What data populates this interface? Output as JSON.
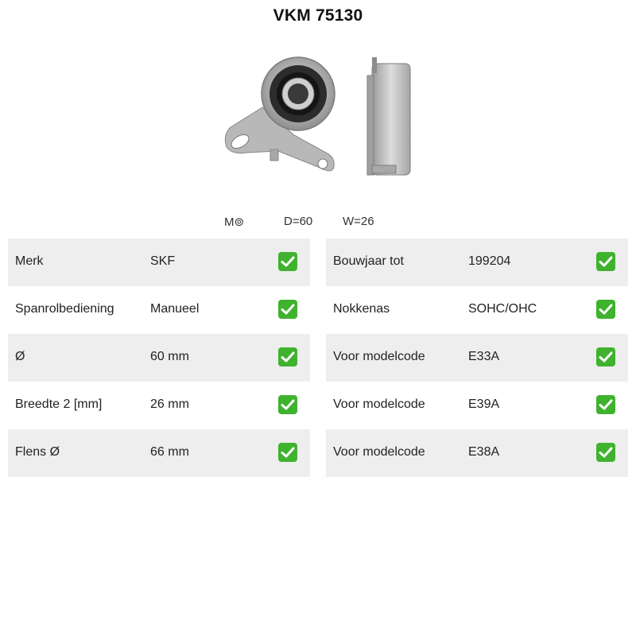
{
  "header": {
    "title": "VKM 75130"
  },
  "product_image": {
    "icon": "belt-tensioner-pulley-image"
  },
  "dimensions": {
    "m_label": "M⊚",
    "d_label": "D=60",
    "w_label": "W=26"
  },
  "check_color": "#3fb22e",
  "left_table": [
    {
      "label": "Merk",
      "value": "SKF"
    },
    {
      "label": "Spanrolbediening",
      "value": "Manueel"
    },
    {
      "label": "Ø",
      "value": "60 mm"
    },
    {
      "label": "Breedte 2 [mm]",
      "value": "26 mm"
    },
    {
      "label": "Flens Ø",
      "value": "66 mm"
    }
  ],
  "right_table": [
    {
      "label": "Bouwjaar tot",
      "value": "199204"
    },
    {
      "label": "Nokkenas",
      "value": "SOHC/OHC"
    },
    {
      "label": "Voor modelcode",
      "value": "E33A"
    },
    {
      "label": "Voor modelcode",
      "value": "E39A"
    },
    {
      "label": "Voor modelcode",
      "value": "E38A"
    }
  ]
}
